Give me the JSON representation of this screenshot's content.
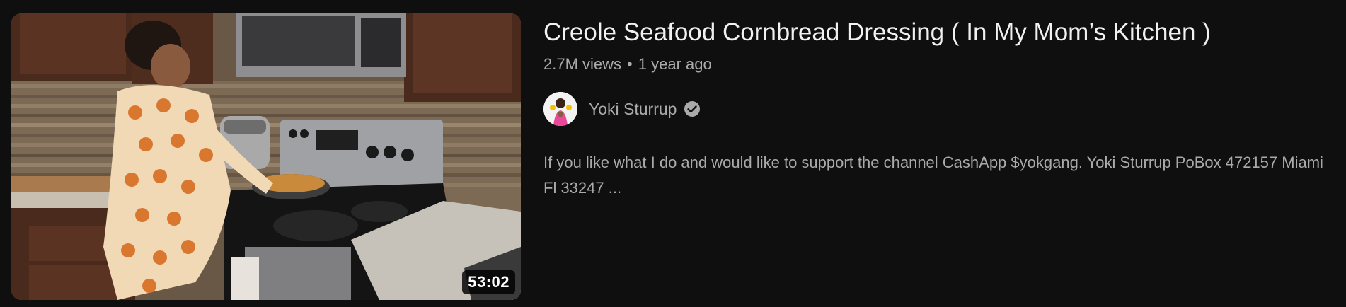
{
  "video": {
    "title": "Creole Seafood Cornbread Dressing ( In My Mom’s Kitchen )",
    "views": "2.7M views",
    "separator": "•",
    "age": "1 year ago",
    "duration": "53:02",
    "description": "If you like what I do and would like to support the channel CashApp $yokgang. Yoki Sturrup PoBox 472157 Miami Fl 33247 ..."
  },
  "channel": {
    "name": "Yoki Sturrup",
    "verified_icon": "verified-check-icon",
    "avatar_icon": "avatar"
  },
  "colors": {
    "background": "#0f0f0f",
    "title": "#f1f1f1",
    "secondary_text": "#aaaaaa",
    "duration_badge_bg": "#000000"
  }
}
